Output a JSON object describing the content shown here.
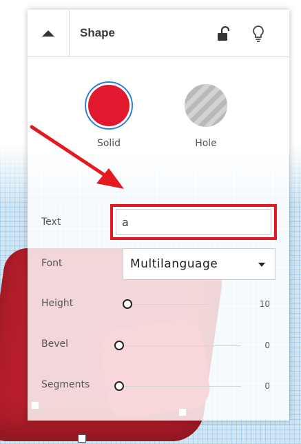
{
  "panel": {
    "title": "Shape"
  },
  "shape_types": {
    "solid_label": "Solid",
    "hole_label": "Hole",
    "solid_color": "#e0192f"
  },
  "text_field": {
    "label": "Text",
    "value": "a"
  },
  "font_field": {
    "label": "Font",
    "value": "Multilanguage"
  },
  "sliders": {
    "height": {
      "label": "Height",
      "value": "10"
    },
    "bevel": {
      "label": "Bevel",
      "value": "0"
    },
    "segments": {
      "label": "Segments",
      "value": "0"
    }
  },
  "icons": {
    "collapse": "triangle-up-icon",
    "lock": "lock-icon",
    "bulb": "lightbulb-icon"
  },
  "colors": {
    "highlight": "#e41a22",
    "selection_ring": "#2f7ed8"
  }
}
